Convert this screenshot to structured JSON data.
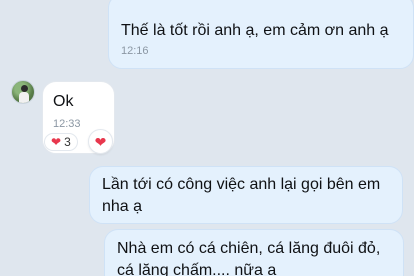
{
  "messages": [
    {
      "id": "m1",
      "direction": "outgoing",
      "text": "Thế là tốt rồi anh ạ, em cảm ơn anh ạ",
      "time": "12:16"
    },
    {
      "id": "m2",
      "direction": "incoming",
      "text": "Ok",
      "time": "12:33",
      "reactions": {
        "icon": "heart-icon",
        "count": "3"
      }
    },
    {
      "id": "m3",
      "direction": "outgoing",
      "text": "Lần tới có công việc anh lại gọi bên em nha ạ"
    },
    {
      "id": "m4",
      "direction": "outgoing",
      "text": "Nhà em có cá chiên, cá lăng đuôi đỏ, cá lăng chấm.... nữa a"
    }
  ],
  "colors": {
    "background": "#dfe6ee",
    "outgoing_bubble": "#e4f1fd",
    "incoming_bubble": "#ffffff",
    "heart": "#e8374d",
    "timestamp": "#8b97a3"
  },
  "icons": {
    "reaction": "heart-icon",
    "react_button": "heart-icon"
  }
}
